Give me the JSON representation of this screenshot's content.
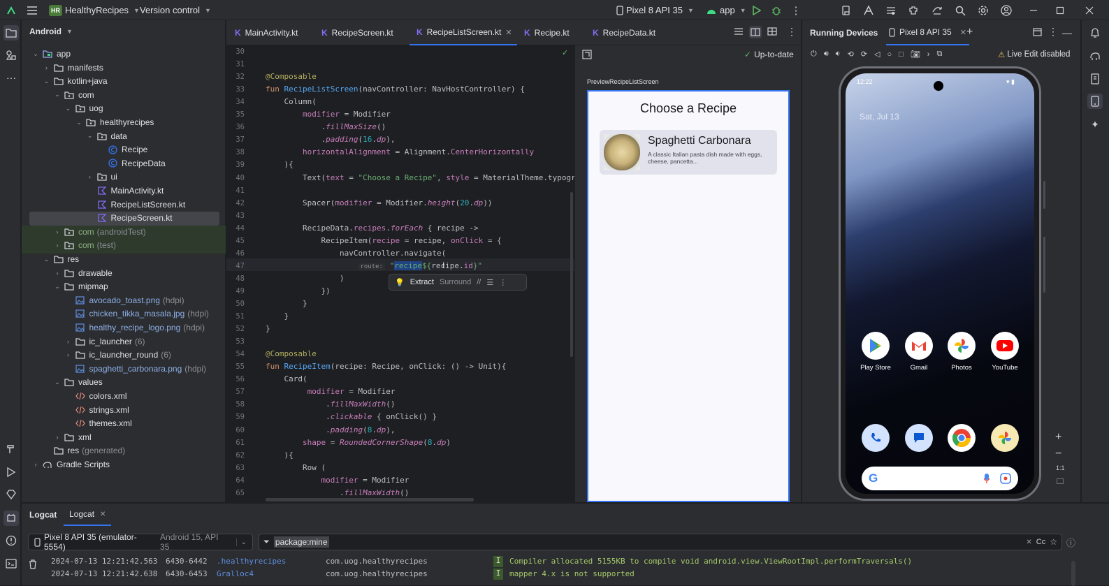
{
  "titlebar": {
    "project_badge": "HR",
    "project_name": "HealthyRecipes",
    "vcs": "Version control",
    "device": "Pixel 8 API 35",
    "run_config": "app"
  },
  "project_panel": {
    "view_mode": "Android",
    "tree": [
      {
        "label": "app",
        "indent": 0,
        "expanded": true,
        "icon": "module-icon"
      },
      {
        "label": "manifests",
        "indent": 1,
        "expanded": false,
        "icon": "folder-icon"
      },
      {
        "label": "kotlin+java",
        "indent": 1,
        "expanded": true,
        "icon": "folder-icon"
      },
      {
        "label": "com",
        "indent": 2,
        "expanded": true,
        "icon": "package-icon"
      },
      {
        "label": "uog",
        "indent": 3,
        "expanded": true,
        "icon": "package-icon"
      },
      {
        "label": "healthyrecipes",
        "indent": 4,
        "expanded": true,
        "icon": "package-icon"
      },
      {
        "label": "data",
        "indent": 5,
        "expanded": true,
        "icon": "package-icon"
      },
      {
        "label": "Recipe",
        "indent": 6,
        "icon": "class-icon"
      },
      {
        "label": "RecipeData",
        "indent": 6,
        "icon": "class-icon"
      },
      {
        "label": "ui",
        "indent": 5,
        "expanded": false,
        "icon": "package-icon"
      },
      {
        "label": "MainActivity.kt",
        "indent": 5,
        "icon": "kotlin-file-icon"
      },
      {
        "label": "RecipeListScreen.kt",
        "indent": 5,
        "icon": "kotlin-file-icon"
      },
      {
        "label": "RecipeScreen.kt",
        "indent": 5,
        "icon": "kotlin-file-icon",
        "selected": true
      },
      {
        "label": "com",
        "suffix": "(androidTest)",
        "indent": 2,
        "expanded": false,
        "icon": "package-icon",
        "test": true
      },
      {
        "label": "com",
        "suffix": "(test)",
        "indent": 2,
        "expanded": false,
        "icon": "package-icon",
        "test": true
      },
      {
        "label": "res",
        "indent": 1,
        "expanded": true,
        "icon": "folder-icon"
      },
      {
        "label": "drawable",
        "indent": 2,
        "expanded": false,
        "icon": "folder-icon"
      },
      {
        "label": "mipmap",
        "indent": 2,
        "expanded": true,
        "icon": "folder-icon"
      },
      {
        "label": "avocado_toast.png",
        "suffix": "(hdpi)",
        "indent": 3,
        "icon": "image-icon",
        "link": true
      },
      {
        "label": "chicken_tikka_masala.jpg",
        "suffix": "(hdpi)",
        "indent": 3,
        "icon": "image-icon",
        "link": true
      },
      {
        "label": "healthy_recipe_logo.png",
        "suffix": "(hdpi)",
        "indent": 3,
        "icon": "image-icon",
        "link": true
      },
      {
        "label": "ic_launcher",
        "suffix": "(6)",
        "indent": 3,
        "expanded": false,
        "icon": "folder-icon"
      },
      {
        "label": "ic_launcher_round",
        "suffix": "(6)",
        "indent": 3,
        "expanded": false,
        "icon": "folder-icon"
      },
      {
        "label": "spaghetti_carbonara.png",
        "suffix": "(hdpi)",
        "indent": 3,
        "icon": "image-icon",
        "link": true
      },
      {
        "label": "values",
        "indent": 2,
        "expanded": true,
        "icon": "folder-icon"
      },
      {
        "label": "colors.xml",
        "indent": 3,
        "icon": "xml-icon"
      },
      {
        "label": "strings.xml",
        "indent": 3,
        "icon": "xml-icon"
      },
      {
        "label": "themes.xml",
        "indent": 3,
        "icon": "xml-icon"
      },
      {
        "label": "xml",
        "indent": 2,
        "expanded": false,
        "icon": "folder-icon"
      },
      {
        "label": "res",
        "suffix": "(generated)",
        "indent": 1,
        "icon": "folder-icon"
      },
      {
        "label": "Gradle Scripts",
        "indent": 0,
        "expanded": false,
        "icon": "gradle-icon"
      }
    ]
  },
  "editor": {
    "tabs": [
      {
        "label": "MainActivity.kt"
      },
      {
        "label": "RecipeScreen.kt"
      },
      {
        "label": "RecipeListScreen.kt",
        "active": true
      },
      {
        "label": "Recipe.kt"
      },
      {
        "label": "RecipeData.kt"
      }
    ],
    "lines": [
      {
        "n": "30",
        "html": ""
      },
      {
        "n": "31",
        "html": ""
      },
      {
        "n": "32",
        "html": "<span class='an'>@Composable</span>"
      },
      {
        "n": "33",
        "html": "<span class='kw'>fun</span> <span class='fn'>RecipeListScreen</span>(navController: NavHostController) {"
      },
      {
        "n": "34",
        "html": "    Column("
      },
      {
        "n": "35",
        "html": "        <span class='pr'>modifier</span> = Modifier"
      },
      {
        "n": "36",
        "html": "            .<span class='it'>fillMaxSize</span>()"
      },
      {
        "n": "37",
        "html": "            .<span class='it'>padding</span>(<span class='nm'>16</span>.<span class='it'>dp</span>),"
      },
      {
        "n": "38",
        "html": "        <span class='pr'>horizontalAlignment</span> = Alignment.<span class='pr'>CenterHorizontally</span>"
      },
      {
        "n": "39",
        "html": "    ){"
      },
      {
        "n": "40",
        "html": "        Text(<span class='pr'>text</span> = <span class='st'>\"Choose a Recipe\"</span>, <span class='pr'>style</span> = MaterialTheme.typogra"
      },
      {
        "n": "41",
        "html": ""
      },
      {
        "n": "42",
        "html": "        Spacer(<span class='pr'>modifier</span> = Modifier.<span class='it'>height</span>(<span class='nm'>20</span>.<span class='it'>dp</span>))"
      },
      {
        "n": "43",
        "html": ""
      },
      {
        "n": "44",
        "html": "        RecipeData.<span class='pr'>recipes</span>.<span class='it'>forEach</span> { recipe ->"
      },
      {
        "n": "45",
        "html": "            RecipeItem(<span class='pr'>recipe</span> = recipe, <span class='pr'>onClick</span> = {"
      },
      {
        "n": "46",
        "html": "                navController.navigate("
      },
      {
        "n": "47",
        "html": "                    <span style='color:#8c8f96;font-size:9px;background:#2b2d30;padding:0 3px'>route:</span> <span class='st'>\"<span style='background:#214283'>recipe</span>${</span>recipe.<span class='pr'>id</span><span class='st'>}\"</span>"
      },
      {
        "n": "48",
        "html": "                )"
      },
      {
        "n": "49",
        "html": "            })"
      },
      {
        "n": "50",
        "html": "        }"
      },
      {
        "n": "51",
        "html": "    }"
      },
      {
        "n": "52",
        "html": "}"
      },
      {
        "n": "53",
        "html": ""
      },
      {
        "n": "54",
        "html": "<span class='an'>@Composable</span>"
      },
      {
        "n": "55",
        "html": "<span class='kw'>fun</span> <span class='fn'>RecipeItem</span>(recipe: Recipe, onClick: () -> Unit){"
      },
      {
        "n": "56",
        "html": "    Card("
      },
      {
        "n": "57",
        "html": "         <span class='pr'>modifier</span> = Modifier"
      },
      {
        "n": "58",
        "html": "             .<span class='it'>fillMaxWidth</span>()"
      },
      {
        "n": "59",
        "html": "             .<span class='it'>clickable</span> { onClick() }"
      },
      {
        "n": "60",
        "html": "             .<span class='it'>padding</span>(<span class='nm'>8</span>.<span class='it'>dp</span>),"
      },
      {
        "n": "61",
        "html": "        <span class='pr'>shape</span> = <span class='it'>RoundedCornerShape</span>(<span class='nm'>8</span>.<span class='it'>dp</span>)"
      },
      {
        "n": "62",
        "html": "    ){"
      },
      {
        "n": "63",
        "html": "        Row ("
      },
      {
        "n": "64",
        "html": "            <span class='pr'>modifier</span> = Modifier"
      },
      {
        "n": "65",
        "html": "                .<span class='it'>fillMaxWidth</span>()"
      }
    ],
    "intention_popup": {
      "extract": "Extract",
      "surround": "Surround"
    }
  },
  "preview": {
    "status": "Up-to-date",
    "name": "PreviewRecipeListScreen",
    "screen_title": "Choose a Recipe",
    "card_title": "Spaghetti Carbonara",
    "card_desc": "A classic Italian pasta dish made with eggs, cheese, pancetta..."
  },
  "running_devices": {
    "title": "Running Devices",
    "device_tab": "Pixel 8 API 35",
    "live_edit": "Live Edit disabled",
    "time": "12:22",
    "date": "Sat, Jul 13",
    "apps_row1": [
      "Play Store",
      "Gmail",
      "Photos",
      "YouTube"
    ],
    "zoom_label": "1:1"
  },
  "logcat": {
    "tabs": [
      "Logcat",
      "Logcat"
    ],
    "device": "Pixel 8 API 35 (emulator-5554)",
    "android_version": "Android 15, API 35",
    "filter": "package:mine",
    "case_toggle": "Cc",
    "entries": [
      {
        "time": "2024-07-13 12:21:42.563",
        "pid": "6430-6442",
        "tag": ".healthyrecipes",
        "pkg": "com.uog.healthyrecipes",
        "level": "I",
        "msg": "Compiler allocated 5155KB to compile void android.view.ViewRootImpl.performTraversals()"
      },
      {
        "time": "2024-07-13 12:21:42.638",
        "pid": "6430-6453",
        "tag": "Gralloc4",
        "pkg": "com.uog.healthyrecipes",
        "level": "I",
        "msg": "mapper 4.x is not supported"
      }
    ]
  }
}
